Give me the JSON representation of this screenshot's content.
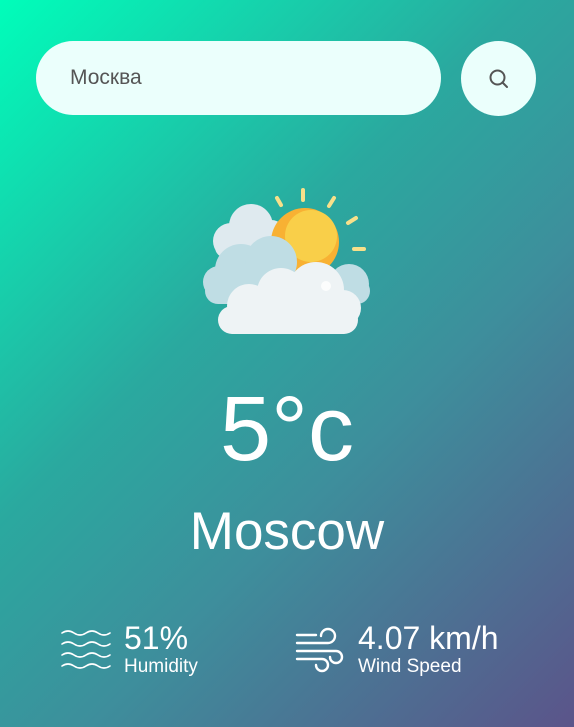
{
  "search": {
    "value": "Москва",
    "icon": "search-icon"
  },
  "weather": {
    "icon": "partly-cloudy-icon",
    "temperature": "5°c",
    "city": "Moscow"
  },
  "details": {
    "humidity": {
      "value": "51%",
      "label": "Humidity",
      "icon": "humidity-waves-icon"
    },
    "wind": {
      "value": "4.07 km/h",
      "label": "Wind Speed",
      "icon": "wind-icon"
    }
  },
  "colors": {
    "gradient_start": "#00feba",
    "gradient_end": "#5b548a",
    "input_background": "#ebfffc"
  }
}
